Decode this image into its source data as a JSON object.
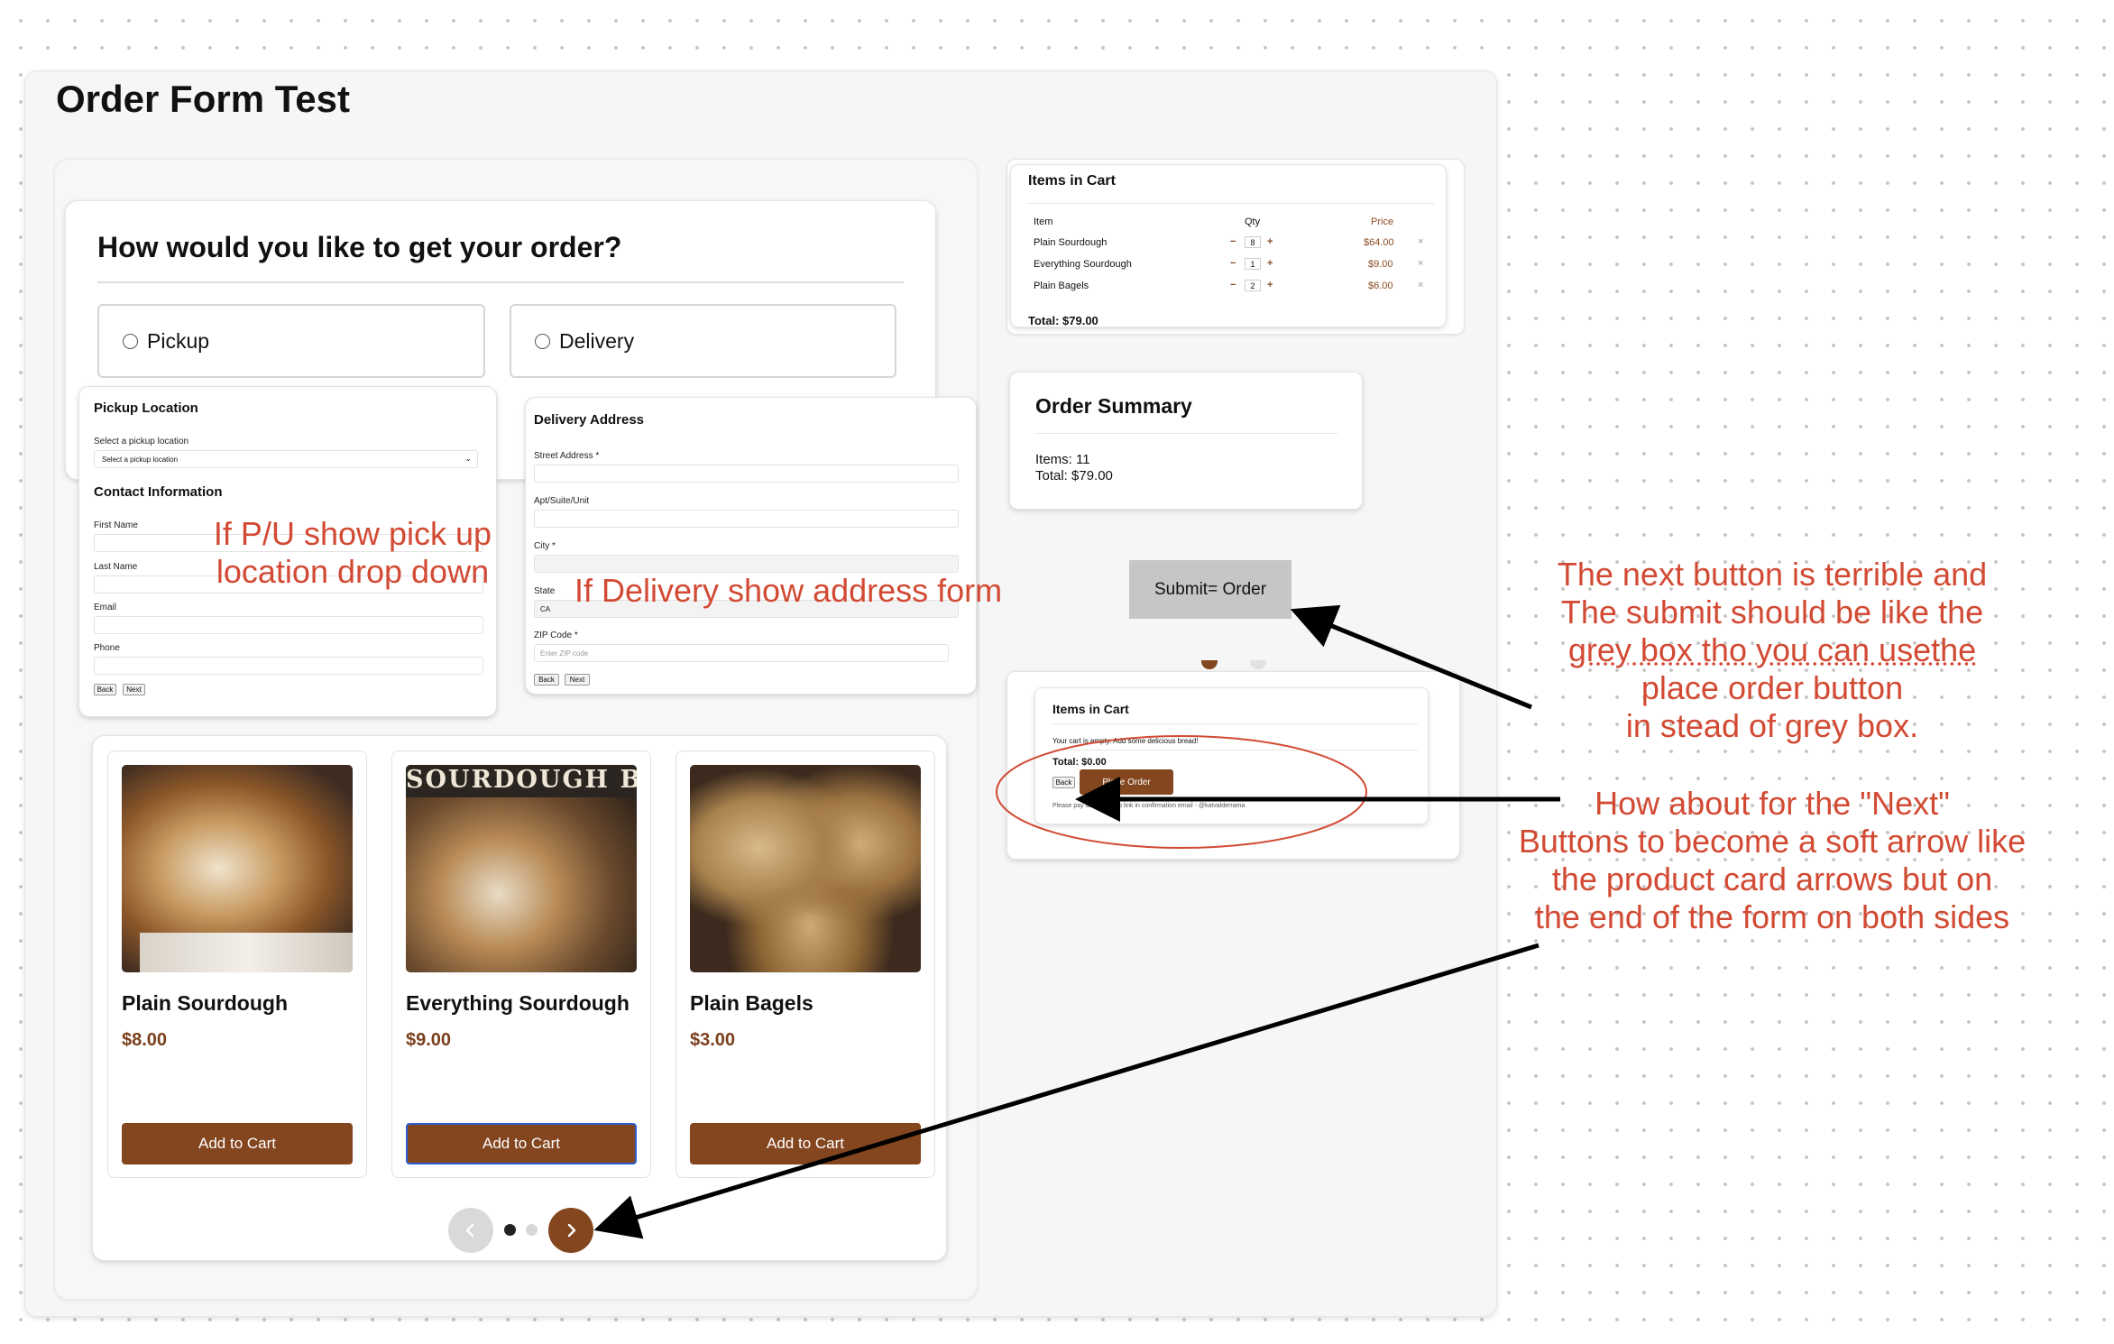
{
  "page": {
    "title": "Order Form Test"
  },
  "delivery_choice": {
    "question": "How would you like to get your order?",
    "options": [
      {
        "label": "Pickup",
        "selected": false
      },
      {
        "label": "Delivery",
        "selected": false
      }
    ]
  },
  "pickup_form": {
    "title": "Pickup Location",
    "select_label": "Select a pickup location",
    "select_value": "Select a pickup location",
    "contact_title": "Contact Information",
    "fields": [
      "First Name",
      "Last Name",
      "Email",
      "Phone"
    ],
    "back_label": "Back",
    "next_label": "Next"
  },
  "delivery_form": {
    "title": "Delivery Address",
    "street_label": "Street Address *",
    "apt_label": "Apt/Suite/Unit",
    "city_label": "City *",
    "state_label": "State",
    "state_value": "CA",
    "zip_label": "ZIP Code *",
    "zip_placeholder": "Enter ZIP code",
    "back_label": "Back",
    "next_label": "Next"
  },
  "cart": {
    "title": "Items in Cart",
    "headers": {
      "item": "Item",
      "qty": "Qty",
      "price": "Price"
    },
    "rows": [
      {
        "item": "Plain Sourdough",
        "qty": "8",
        "price": "$64.00"
      },
      {
        "item": "Everything Sourdough",
        "qty": "1",
        "price": "$9.00"
      },
      {
        "item": "Plain Bagels",
        "qty": "2",
        "price": "$6.00"
      }
    ],
    "minus": "−",
    "plus": "+",
    "remove": "×",
    "total": "Total: $79.00"
  },
  "summary": {
    "title": "Order Summary",
    "items": "Items: 11",
    "total": "Total: $79.00"
  },
  "submit_box": {
    "label": "Submit=  Order"
  },
  "empty_cart": {
    "title": "Items in Cart",
    "message": "Your cart is empty. Add some delicious bread!",
    "total": "Total: $0.00",
    "back_label": "Back",
    "place_order_label": "Place Order",
    "note": "Please pay using Venmo link in confirmation email - @katvalderrama"
  },
  "products": [
    {
      "name": "Plain Sourdough",
      "price": "$8.00",
      "button": "Add to Cart",
      "image": "plain-sourdough-photo"
    },
    {
      "name": "Everything Sourdough",
      "price": "$9.00",
      "button": "Add to Cart",
      "image": "everything-sourdough-photo",
      "image_text": "SOURDOUGH BREAD"
    },
    {
      "name": "Plain Bagels",
      "price": "$3.00",
      "button": "Add to Cart",
      "image": "plain-bagels-photo"
    }
  ],
  "carousel": {
    "prev_icon": "chevron-left-icon",
    "next_icon": "chevron-right-icon",
    "pages": 2,
    "active_page": 1
  },
  "annotations": {
    "pickup_note": [
      "If P/U show pick up",
      "location drop down"
    ],
    "delivery_note": "If Delivery show address form",
    "submit_note": [
      "The next button is terrible and",
      "The submit should be like the",
      "grey box tho you can usethe",
      "place order button",
      "in stead of grey box."
    ],
    "next_note": [
      "How about for the \"Next\"",
      "Buttons to become a soft arrow like",
      "the product card arrows but on",
      "the end of the form on both sides"
    ]
  },
  "colors": {
    "brand_brown": "#83461f",
    "annotation_red": "#d24a33",
    "grey_box": "#c6c6c6"
  }
}
